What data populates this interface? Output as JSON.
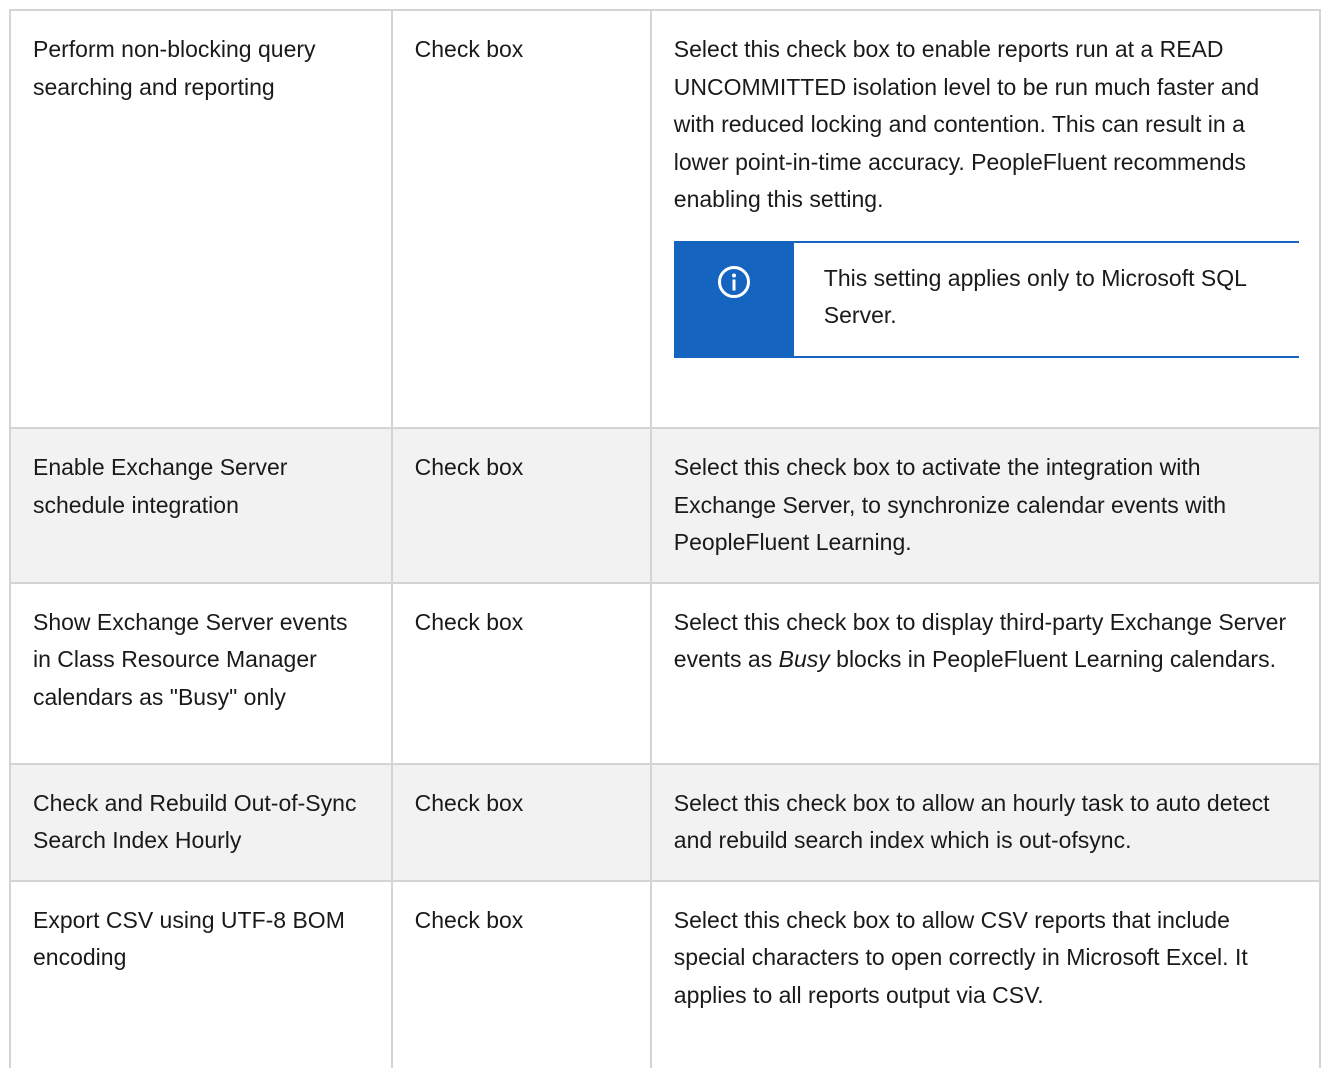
{
  "rows": [
    {
      "name": "Perform non-blocking query searching and reporting",
      "type": "Check box",
      "description": "Select this check box to enable reports run at a READ UNCOMMITTED isolation level to be run much faster and with reduced locking and contention. This can result in a lower point-in-time accuracy. PeopleFluent recommends enabling this setting.",
      "note": {
        "icon": "info-icon",
        "text": "This setting applies only to Microsoft SQL Server."
      }
    },
    {
      "name": "Enable Exchange Server schedule integration",
      "type": "Check box",
      "description": "Select this check box to activate the integration with Exchange Server, to synchronize calendar events with PeopleFluent Learning."
    },
    {
      "name": "Show Exchange Server events in Class Resource Manager calendars as \"Busy\" only",
      "type": "Check box",
      "description_before": "Select this check box to display third-party Exchange Server events as ",
      "description_emphasis": "Busy",
      "description_after": " blocks in PeopleFluent Learning calendars."
    },
    {
      "name": "Check and Rebuild Out-of-Sync Search Index Hourly",
      "type": "Check box",
      "description": "Select this check box to allow an hourly task to auto detect and rebuild search index which is out-ofsync."
    },
    {
      "name": "Export CSV using UTF-8 BOM encoding",
      "type": "Check box",
      "description": "Select this check box to allow CSV reports that include special characters to open correctly in Microsoft Excel. It applies to all reports output via CSV."
    }
  ],
  "colors": {
    "note_accent": "#1565c0",
    "shaded_row": "#f2f2f2",
    "border": "#d4d4d4"
  }
}
